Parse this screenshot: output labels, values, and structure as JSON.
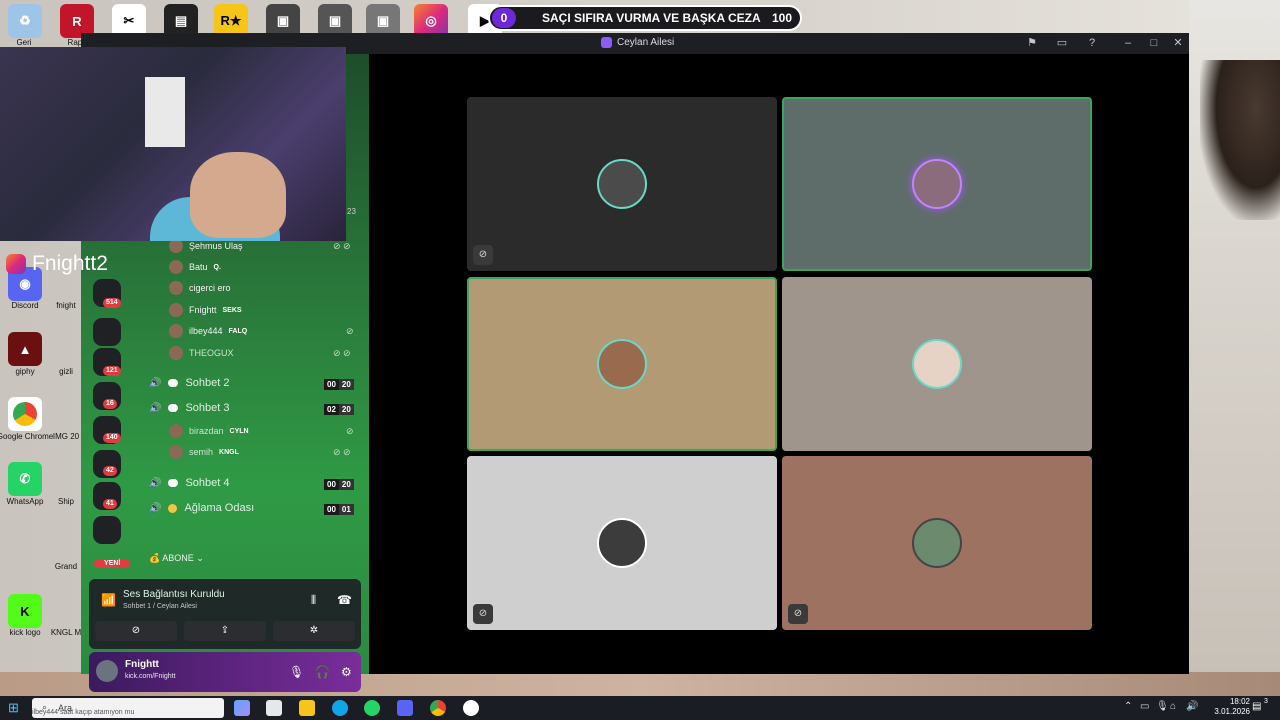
{
  "window": {
    "title": "Ceylan Ailesi"
  },
  "vote": {
    "left_count": "0",
    "text": "SAÇI SIFIRA VURMA VE BAŞKA CEZA",
    "right_count": "100"
  },
  "overlay": {
    "social_handle": "Fnightt2",
    "cam_number": "23"
  },
  "members_top": [
    {
      "name": "Şehmus Ulaş",
      "tag": ""
    },
    {
      "name": "Batu",
      "tag": "Q."
    },
    {
      "name": "cigerci ero",
      "tag": ""
    },
    {
      "name": "Fnightt",
      "tag": "SEKS"
    },
    {
      "name": "ilbey444",
      "tag": "FALQ"
    },
    {
      "name": "THEOGUX",
      "tag": ""
    }
  ],
  "channels": [
    {
      "name": "Sohbet 2",
      "count_a": "00",
      "count_b": "20"
    },
    {
      "name": "Sohbet 3",
      "count_a": "02",
      "count_b": "20"
    },
    {
      "name": "Sohbet 4",
      "count_a": "00",
      "count_b": "20"
    },
    {
      "name": "Ağlama Odası",
      "count_a": "00",
      "count_b": "01"
    }
  ],
  "members_sohbet3": [
    {
      "name": "birazdan",
      "tag": "CYLN"
    },
    {
      "name": "semih",
      "tag": "KNGL"
    }
  ],
  "server_badges": [
    "514",
    "121",
    "16",
    "140",
    "42",
    "41"
  ],
  "new_badge": "YENİ",
  "abone": "ABONE",
  "voice": {
    "status": "Ses Bağlantısı Kuruldu",
    "channel": "Sohbet 1 / Ceylan Ailesi"
  },
  "user": {
    "name": "Fnightt",
    "status": "kick.com/Fnightt"
  },
  "desktop": {
    "left_icons": [
      "Discord",
      "giphy",
      "Google Chrome",
      "WhatsApp",
      "kick logo"
    ],
    "second_col": [
      "fnight",
      "gizli",
      "IMG 20",
      "Ship",
      "Grand",
      "KNGL M"
    ],
    "top_labels": [
      "Geri",
      "Rapid"
    ]
  },
  "taskbar": {
    "search": "Ara",
    "tip": "ilbey444 saat kaçıp atamıyon mu",
    "time": "18:02",
    "date": "3.01.2026",
    "notif": "3"
  },
  "colors": {
    "speaking": "#3ba55c",
    "accent": "#6d28d9"
  }
}
